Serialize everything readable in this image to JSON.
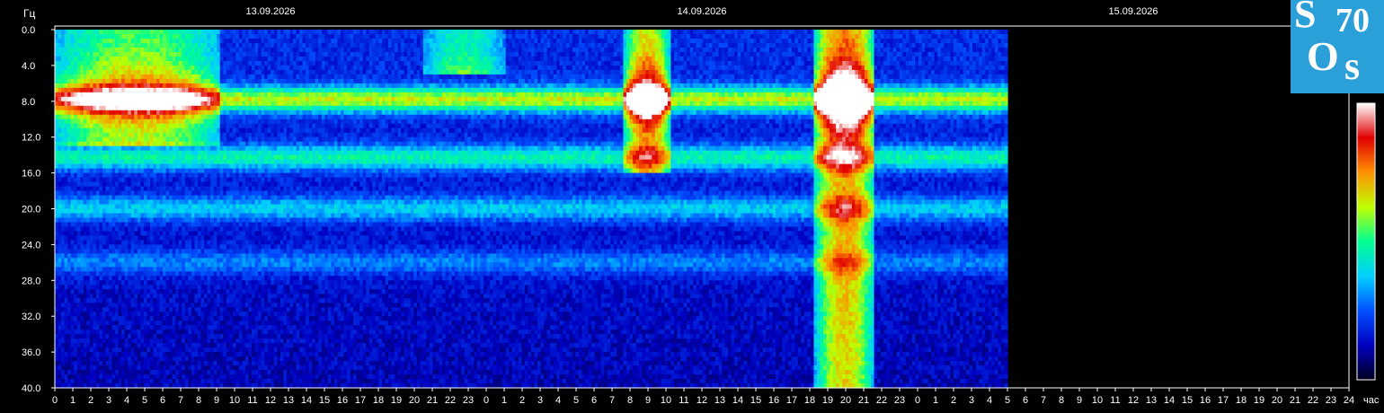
{
  "chart_data": {
    "type": "heatmap",
    "title": "",
    "ylabel": "Гц",
    "xlabel": "час",
    "ylim": [
      0,
      40
    ],
    "y_ticks": [
      "0.0",
      "4.0",
      "8.0",
      "12.0",
      "16.0",
      "20.0",
      "24.0",
      "28.0",
      "32.0",
      "36.0",
      "40.0"
    ],
    "x_range_hours": [
      0,
      72
    ],
    "data_end_hour": 53,
    "x_ticks": [
      "0",
      "1",
      "2",
      "3",
      "4",
      "5",
      "6",
      "7",
      "8",
      "9",
      "10",
      "11",
      "12",
      "13",
      "14",
      "15",
      "16",
      "17",
      "18",
      "19",
      "20",
      "21",
      "22",
      "23",
      "0",
      "1",
      "2",
      "3",
      "4",
      "5",
      "6",
      "7",
      "8",
      "9",
      "10",
      "11",
      "12",
      "13",
      "14",
      "15",
      "16",
      "17",
      "18",
      "19",
      "20",
      "21",
      "22",
      "23",
      "0",
      "1",
      "2",
      "3",
      "4",
      "5",
      "6",
      "7",
      "8",
      "9",
      "10",
      "11",
      "12",
      "13",
      "14",
      "15",
      "16",
      "17",
      "18",
      "19",
      "20",
      "21",
      "22",
      "23",
      "24"
    ],
    "date_labels": [
      {
        "label": "13.09.2026",
        "hour": 12
      },
      {
        "label": "14.09.2026",
        "hour": 36
      },
      {
        "label": "15.09.2026",
        "hour": 60
      }
    ],
    "bands": [
      {
        "freq": 7.8,
        "intensity": 0.45
      },
      {
        "freq": 14.3,
        "intensity": 0.3
      },
      {
        "freq": 20.0,
        "intensity": 0.22
      },
      {
        "freq": 26.0,
        "intensity": 0.15
      }
    ],
    "bursts": [
      {
        "hour_start": 0,
        "hour_end": 9.2,
        "freq_max": 13,
        "intensity": 0.6
      },
      {
        "hour_start": 20.5,
        "hour_end": 25,
        "freq_max": 5,
        "intensity": 0.45
      },
      {
        "hour_start": 31.7,
        "hour_end": 34.2,
        "freq_max": 16,
        "intensity": 0.8
      },
      {
        "hour_start": 42.3,
        "hour_end": 45.6,
        "freq_max": 40,
        "intensity": 1.0
      }
    ],
    "colorscale": [
      "#000020",
      "#0000c0",
      "#0050ff",
      "#00d0ff",
      "#00ff90",
      "#c0ff00",
      "#ff9000",
      "#e00000",
      "#ffffff"
    ]
  },
  "logo": {
    "s1": "S",
    "number": "70",
    "o": "O",
    "s2": "s"
  }
}
